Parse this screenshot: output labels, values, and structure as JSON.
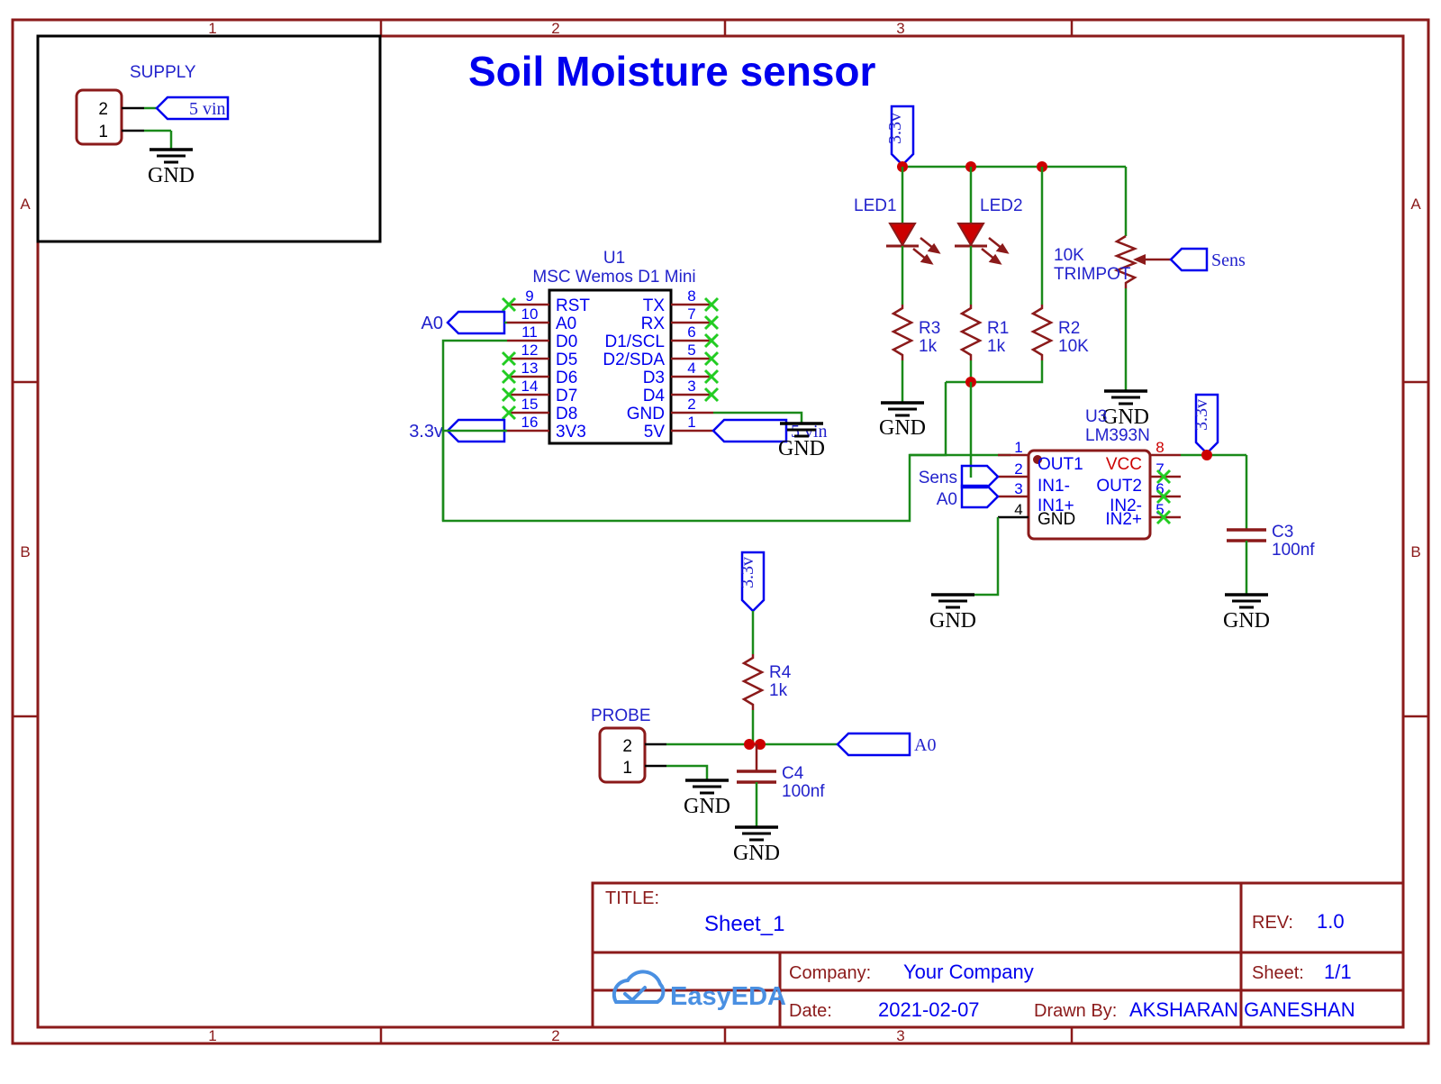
{
  "sheet": {
    "title": "Soil Moisture sensor",
    "zone_cols": [
      "1",
      "2",
      "3"
    ],
    "zone_rows": [
      "A",
      "B"
    ],
    "colors": {
      "border": "#8b1a1a",
      "wire_green": "#1a8a1a",
      "pin_red": "#8b1a1a",
      "label_blue": "#0000ee",
      "vcc_red": "#ee0000",
      "nc_green": "#22cc22",
      "black": "#000000"
    }
  },
  "supply_block": {
    "designator": "SUPPLY",
    "pins": [
      "2",
      "1"
    ],
    "net_port": "5 vin",
    "gnd": "GND"
  },
  "u1": {
    "designator": "U1",
    "name": "MSC Wemos D1 Mini",
    "left_pins": [
      {
        "num": "9",
        "label": "RST",
        "nc": true
      },
      {
        "num": "10",
        "label": "A0",
        "nc": false
      },
      {
        "num": "11",
        "label": "D0",
        "nc": false
      },
      {
        "num": "12",
        "label": "D5",
        "nc": true
      },
      {
        "num": "13",
        "label": "D6",
        "nc": true
      },
      {
        "num": "14",
        "label": "D7",
        "nc": true
      },
      {
        "num": "15",
        "label": "D8",
        "nc": true
      },
      {
        "num": "16",
        "label": "3V3",
        "nc": false
      }
    ],
    "right_pins": [
      {
        "num": "8",
        "label": "TX",
        "nc": true
      },
      {
        "num": "7",
        "label": "RX",
        "nc": true
      },
      {
        "num": "6",
        "label": "D1/SCL",
        "nc": true
      },
      {
        "num": "5",
        "label": "D2/SDA",
        "nc": true
      },
      {
        "num": "4",
        "label": "D3",
        "nc": true
      },
      {
        "num": "3",
        "label": "D4",
        "nc": true
      },
      {
        "num": "2",
        "label": "GND",
        "nc": false
      },
      {
        "num": "1",
        "label": "5V",
        "nc": false
      }
    ],
    "port_a0": "A0",
    "port_33v": "3.3v",
    "port_5vin": "5 vin",
    "gnd": "GND"
  },
  "u3": {
    "designator": "U3",
    "name": "LM393N",
    "left_pins": [
      {
        "num": "1",
        "label": "OUT1",
        "nc": false
      },
      {
        "num": "2",
        "label": "IN1-",
        "nc": false
      },
      {
        "num": "3",
        "label": "IN1+",
        "nc": false
      },
      {
        "num": "4",
        "label": "GND",
        "nc": false
      }
    ],
    "right_pins": [
      {
        "num": "8",
        "label": "VCC",
        "nc": false
      },
      {
        "num": "7",
        "label": "OUT2",
        "nc": true
      },
      {
        "num": "6",
        "label": "IN2-",
        "nc": true
      },
      {
        "num": "5",
        "label": "IN2+",
        "nc": true
      }
    ],
    "port_sens": "Sens",
    "port_a0": "A0",
    "port_33v": "3.3v",
    "gnd": "GND"
  },
  "leds": [
    {
      "designator": "LED1"
    },
    {
      "designator": "LED2"
    }
  ],
  "resistors": [
    {
      "designator": "R3",
      "value": "1k"
    },
    {
      "designator": "R1",
      "value": "1k"
    },
    {
      "designator": "R2",
      "value": "10K"
    },
    {
      "designator": "R4",
      "value": "1k"
    }
  ],
  "trimpot": {
    "value": "10K",
    "type": "TRIMPOT",
    "port_sens": "Sens",
    "gnd": "GND"
  },
  "capacitors": [
    {
      "designator": "C3",
      "value": "100nf",
      "gnd": "GND"
    },
    {
      "designator": "C4",
      "value": "100nf",
      "gnd": "GND"
    }
  ],
  "probe_block": {
    "designator": "PROBE",
    "pins": [
      "2",
      "1"
    ],
    "net_port": "A0",
    "port_33v": "3.3v",
    "gnd": "GND"
  },
  "power_ports": {
    "v33": "3.3v",
    "v5in": "5 vin",
    "gnd": "GND"
  },
  "title_block": {
    "title_label": "TITLE:",
    "title_value": "Sheet_1",
    "rev_label": "REV:",
    "rev_value": "1.0",
    "company_label": "Company:",
    "company_value": "Your Company",
    "sheet_label": "Sheet:",
    "sheet_value": "1/1",
    "date_label": "Date:",
    "date_value": "2021-02-07",
    "drawn_label": "Drawn By:",
    "drawn_value": "AKSHARAN GANESHAN",
    "logo_text": "EasyEDA"
  }
}
